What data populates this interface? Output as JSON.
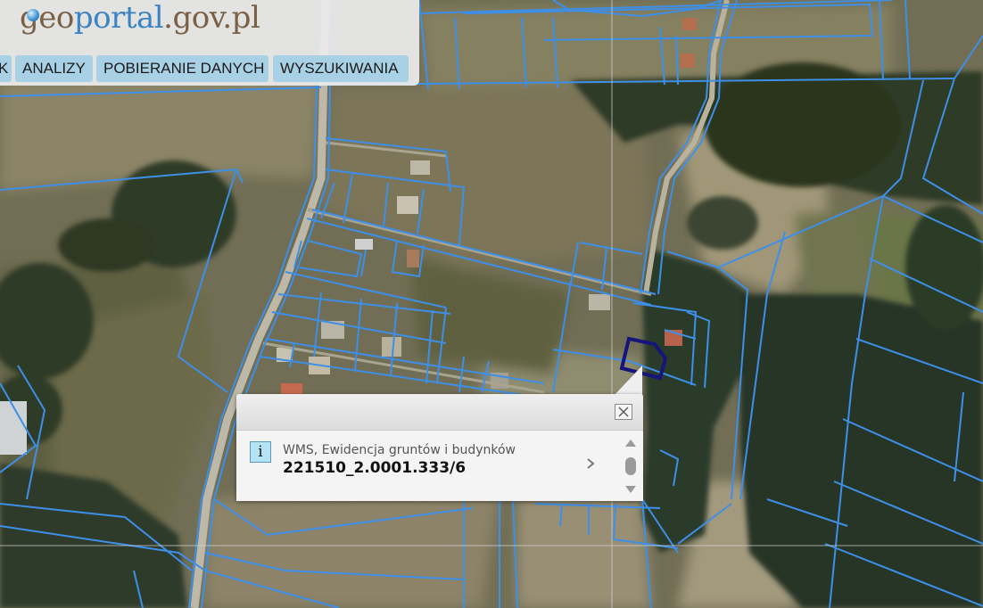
{
  "header": {
    "logo": {
      "part1": "geo",
      "part2": "portal",
      "part3": ".gov.pl"
    },
    "nav": [
      "K",
      "ANALIZY",
      "POBIERANIE DANYCH",
      "WYSZUKIWANIA"
    ]
  },
  "popup": {
    "layer_name": "WMS, Ewidencja gruntów i budynków",
    "parcel_id": "221510_2.0001.333/6"
  },
  "colors": {
    "parcel_lines": "#3d8fe8",
    "selected_parcel": "#14147a",
    "nav_button": "#a9d1e6"
  },
  "icons": [
    "info-icon",
    "close-icon",
    "chevron-right-icon",
    "scroll-up-icon",
    "scroll-down-icon"
  ]
}
